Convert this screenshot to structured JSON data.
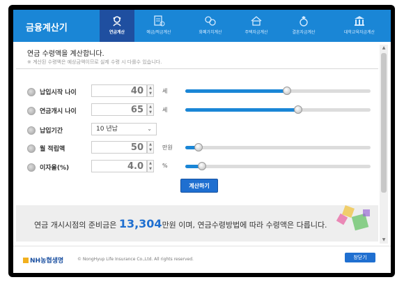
{
  "app": {
    "title": "금융계산기"
  },
  "tabs": [
    {
      "label": "연금계산",
      "icon": "pension-icon",
      "active": true
    },
    {
      "label": "예금/적금계산",
      "icon": "savings-icon",
      "active": false
    },
    {
      "label": "화폐가치계산",
      "icon": "coins-icon",
      "active": false
    },
    {
      "label": "주택자금계산",
      "icon": "house-icon",
      "active": false
    },
    {
      "label": "결혼자금계산",
      "icon": "ring-icon",
      "active": false
    },
    {
      "label": "대학교육자금계산",
      "icon": "university-icon",
      "active": false
    }
  ],
  "main": {
    "heading": "연금 수령액을 계산합니다.",
    "note": "※ 계산된 수령액은 예상금액이므로 실제 수령 시 다를수 있습니다."
  },
  "fields": {
    "start_age": {
      "label": "납입시작 나이",
      "value": "40",
      "unit": "세",
      "slider_level": 0.55
    },
    "pension_age": {
      "label": "연금개시 나이",
      "value": "65",
      "unit": "세",
      "slider_level": 0.61
    },
    "period": {
      "label": "납입기간",
      "value": "10 년납"
    },
    "monthly": {
      "label": "월 적립액",
      "value": "50",
      "unit": "만원",
      "slider_level": 0.07
    },
    "rate": {
      "label": "이자율(%)",
      "value": "4.0",
      "unit": "%",
      "slider_level": 0.09
    }
  },
  "calc_button": "계산하기",
  "result": {
    "prefix": "연금 개시시점의 준비금은",
    "amount": "13,304",
    "suffix": "만원 이며, 연금수령방법에 따라 수령액은 다릅니다."
  },
  "footer": {
    "logo": "NH농협생명",
    "copyright": "© NongHyup Life Insurance Co.,Ltd. All rights reserved.",
    "close_label": "창닫기"
  },
  "colors": {
    "accent": "#1a86d6",
    "active_tab": "#1f4fa0",
    "button": "#1f6fd0"
  }
}
